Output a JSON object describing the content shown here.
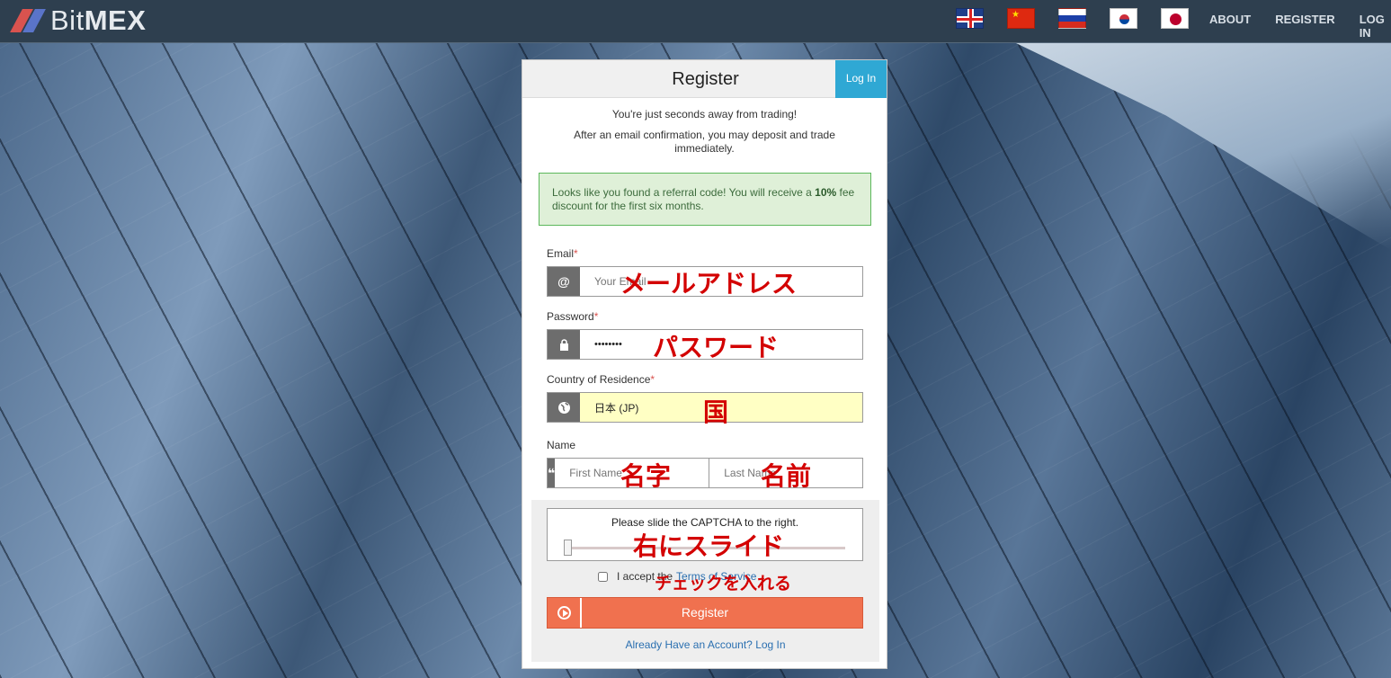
{
  "header": {
    "logo_prefix": "Bit",
    "logo_bold": "MEX",
    "flags": [
      "flag-uk-icon",
      "flag-china-icon",
      "flag-russia-icon",
      "flag-korea-icon",
      "flag-japan-icon"
    ],
    "nav": [
      "ABOUT",
      "REGISTER",
      "LOG IN"
    ]
  },
  "panel": {
    "title": "Register",
    "login_tab": "Log In",
    "intro_1": "You're just seconds away from trading!",
    "intro_2": "After an email confirmation, you may deposit and trade immediately.",
    "alert_pre": "Looks like you found a referral code! You will receive a ",
    "alert_bold": "10%",
    "alert_post": " fee discount for the first six months.",
    "email_label": "Email",
    "email_placeholder": "Your Email",
    "password_label": "Password",
    "password_value": "••••••••",
    "country_label": "Country of Residence",
    "country_value": "日本 (JP)",
    "name_label": "Name",
    "first_placeholder": "First Name",
    "last_placeholder": "Last Name",
    "required_mark": "*",
    "captcha_text": "Please slide the CAPTCHA to the right.",
    "terms_pre": "I accept the",
    "terms_link": "Terms of Service",
    "register_button": "Register",
    "already": "Already Have an Account? Log In"
  },
  "annotations": {
    "email": "メールアドレス",
    "password": "パスワード",
    "country": "国",
    "first_name": "名字",
    "last_name": "名前",
    "slider": "右にスライド",
    "checkbox": "チェックを入れる"
  },
  "colors": {
    "accent": "#2fa8d4",
    "register": "#f0714f",
    "annotation": "#d30000"
  }
}
